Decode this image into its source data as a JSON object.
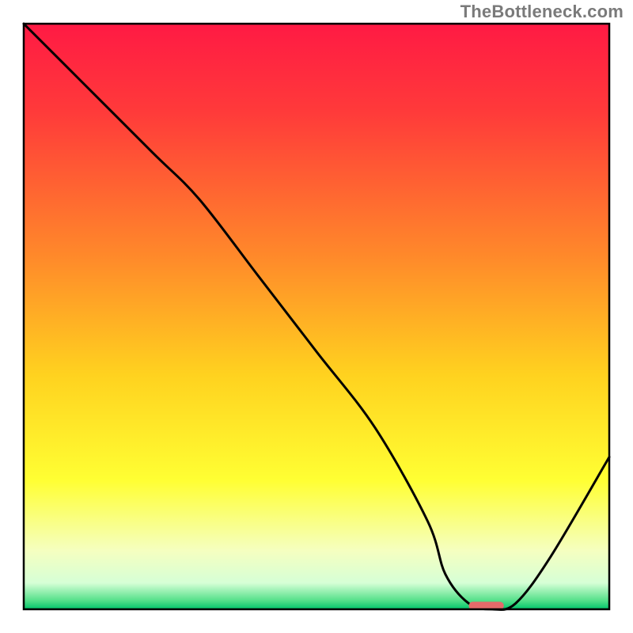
{
  "watermark": "TheBottleneck.com",
  "chart_data": {
    "type": "line",
    "title": "",
    "xlabel": "",
    "ylabel": "",
    "xlim": [
      0,
      100
    ],
    "ylim": [
      0,
      100
    ],
    "grid": false,
    "legend": false,
    "gradient_stops": [
      {
        "offset": 0.0,
        "color": "#ff1a44"
      },
      {
        "offset": 0.15,
        "color": "#ff3a3a"
      },
      {
        "offset": 0.4,
        "color": "#ff8a2a"
      },
      {
        "offset": 0.6,
        "color": "#ffd21f"
      },
      {
        "offset": 0.78,
        "color": "#ffff33"
      },
      {
        "offset": 0.9,
        "color": "#f5ffc0"
      },
      {
        "offset": 0.955,
        "color": "#d6ffd6"
      },
      {
        "offset": 0.985,
        "color": "#55e08a"
      },
      {
        "offset": 1.0,
        "color": "#00c46a"
      }
    ],
    "series": [
      {
        "name": "bottleneck-curve",
        "x": [
          0,
          10,
          22,
          30,
          40,
          50,
          60,
          69,
          72,
          76,
          80,
          84,
          90,
          100
        ],
        "y": [
          100,
          90,
          78,
          70,
          57,
          44,
          31,
          15,
          6,
          1,
          0,
          1,
          9,
          26
        ]
      }
    ],
    "marker": {
      "name": "optimal-marker",
      "x_start": 76,
      "x_end": 82,
      "y": 0.6,
      "color": "#e46a6a"
    },
    "frame": {
      "color": "#000000",
      "strokeWidth": 2.5
    }
  }
}
